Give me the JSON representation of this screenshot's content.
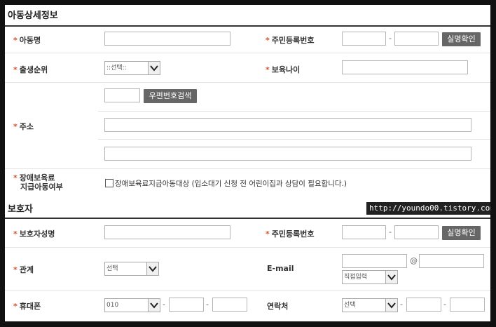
{
  "child_section": {
    "title": "아동상세정보",
    "name_label": "아동명",
    "rrn_label": "주민등록번호",
    "verify_button": "실명확인",
    "birth_order_label": "출생순위",
    "birth_order_value": "::선택::",
    "care_age_label": "보육나이",
    "address_label": "주소",
    "zip_search_button": "우편번호검색",
    "disability_label_1": "장애보육료",
    "disability_label_2": "지급아동여부",
    "disability_checkbox_text": "장애보육료지급아동대상 (입소대기 신청 전 어린이집과 상담이 필요합니다.)"
  },
  "guardian_section": {
    "title": "보호자",
    "name_label": "보호자성명",
    "rrn_label": "주민등록번호",
    "verify_button": "실명확인",
    "relation_label": "관계",
    "relation_value": "선택",
    "email_label": "E-mail",
    "email_at": "@",
    "email_domain_value": "직접입력",
    "mobile_label": "휴대폰",
    "mobile_prefix_value": "010",
    "contact_label": "연락처",
    "contact_prefix_value": "선택"
  },
  "common": {
    "required_marker": "*",
    "dash": "-"
  },
  "watermark": "http://youndo00.tistory.com"
}
